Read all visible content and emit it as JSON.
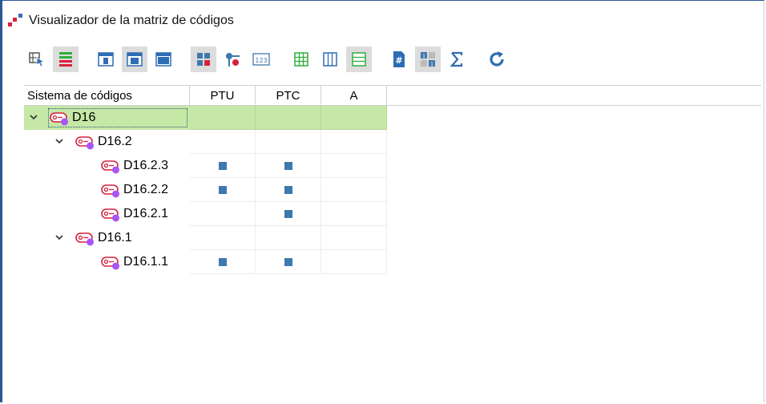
{
  "window": {
    "title": "Visualizador de la matriz de códigos"
  },
  "toolbar": {
    "buttons": [
      {
        "name": "select-tool-button",
        "icon": "cursor-grid-icon",
        "active": false
      },
      {
        "name": "color-bars-button",
        "icon": "color-bars-icon",
        "active": true
      },
      {
        "name": "layout-1-button",
        "icon": "window-layout-icon",
        "active": false
      },
      {
        "name": "layout-2-button",
        "icon": "window-layout-icon",
        "active": true
      },
      {
        "name": "layout-3-button",
        "icon": "window-full-icon",
        "active": false
      },
      {
        "name": "symbols-button",
        "icon": "squares-icon",
        "active": true
      },
      {
        "name": "nodes-button",
        "icon": "nodes-icon",
        "active": false
      },
      {
        "name": "numbers-button",
        "icon": "numbers-123-icon",
        "active": false
      },
      {
        "name": "grid-button",
        "icon": "grid-icon",
        "active": false
      },
      {
        "name": "columns-button",
        "icon": "columns-icon",
        "active": false
      },
      {
        "name": "rows-button",
        "icon": "rows-icon",
        "active": true
      },
      {
        "name": "hash-button",
        "icon": "hash-icon",
        "active": false
      },
      {
        "name": "binary-button",
        "icon": "binary-matrix-icon",
        "active": true
      },
      {
        "name": "sum-button",
        "icon": "sigma-icon",
        "active": false
      },
      {
        "name": "refresh-button",
        "icon": "refresh-icon",
        "active": false
      }
    ]
  },
  "grid": {
    "tree_header": "Sistema de códigos",
    "columns": [
      "PTU",
      "PTC",
      "A"
    ],
    "rows": [
      {
        "label": "D16",
        "level": 0,
        "expandable": true,
        "selected": true,
        "marks": [
          false,
          false,
          false
        ]
      },
      {
        "label": "D16.2",
        "level": 1,
        "expandable": true,
        "selected": false,
        "marks": [
          false,
          false,
          false
        ]
      },
      {
        "label": "D16.2.3",
        "level": 2,
        "expandable": false,
        "selected": false,
        "marks": [
          true,
          true,
          false
        ]
      },
      {
        "label": "D16.2.2",
        "level": 2,
        "expandable": false,
        "selected": false,
        "marks": [
          true,
          true,
          false
        ]
      },
      {
        "label": "D16.2.1",
        "level": 2,
        "expandable": false,
        "selected": false,
        "marks": [
          false,
          true,
          false
        ]
      },
      {
        "label": "D16.1",
        "level": 1,
        "expandable": true,
        "selected": false,
        "marks": [
          false,
          false,
          false
        ]
      },
      {
        "label": "D16.1.1",
        "level": 2,
        "expandable": false,
        "selected": false,
        "marks": [
          true,
          true,
          false
        ]
      }
    ]
  },
  "colors": {
    "selection": "#c5e8a6",
    "mark": "#3f78b0",
    "code_icon": "#d9213b",
    "code_dot": "#a855f7"
  }
}
